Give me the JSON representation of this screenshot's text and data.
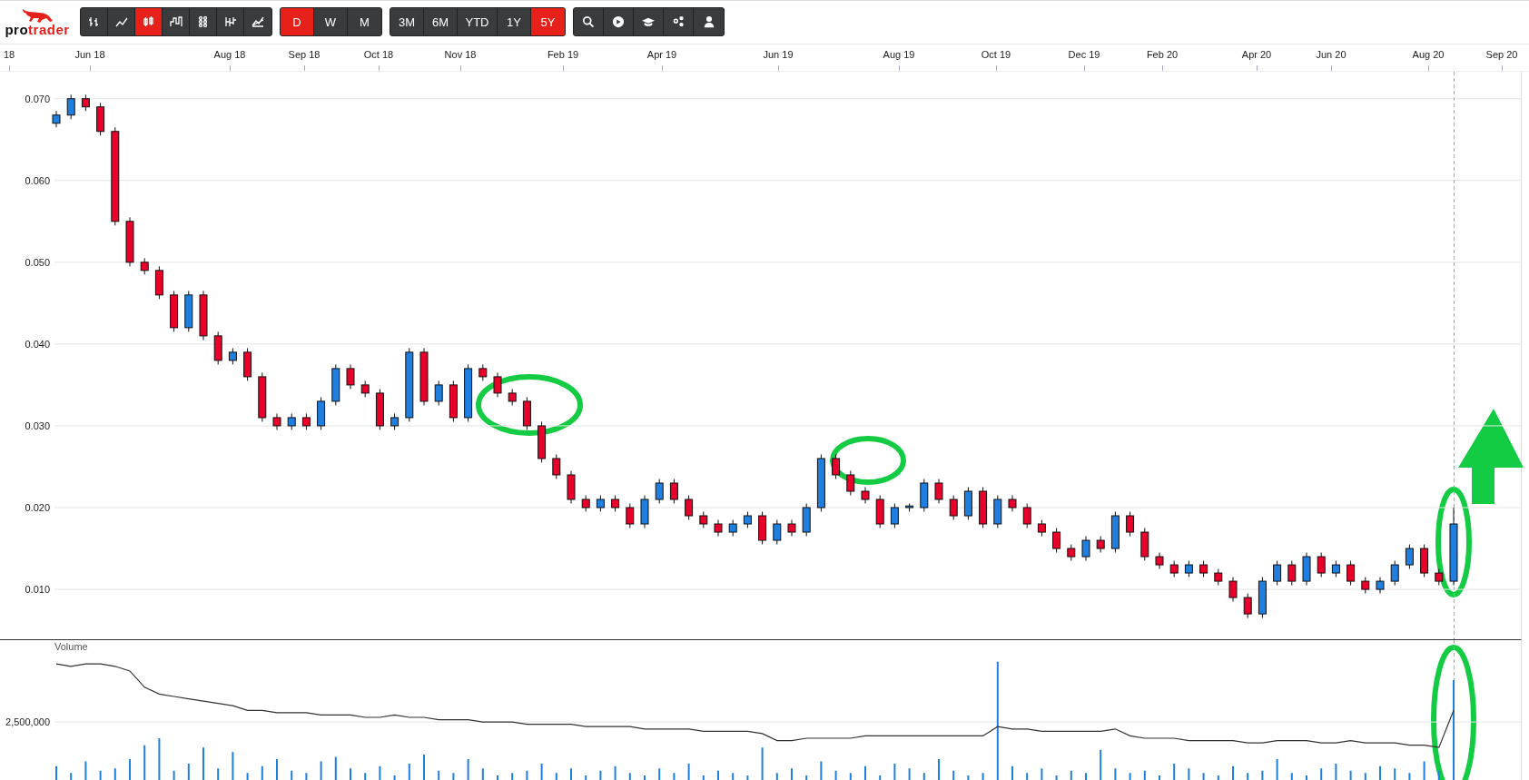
{
  "logo": {
    "prefix": "pro",
    "suffix": "trader"
  },
  "chart_types": [
    {
      "selected": false
    },
    {
      "selected": false
    },
    {
      "selected": true
    },
    {
      "selected": false
    },
    {
      "selected": false
    },
    {
      "selected": false
    },
    {
      "selected": false
    }
  ],
  "intervals": [
    {
      "label": "D",
      "selected": true
    },
    {
      "label": "W",
      "selected": false
    },
    {
      "label": "M",
      "selected": false
    }
  ],
  "ranges": [
    {
      "label": "3M",
      "selected": false
    },
    {
      "label": "6M",
      "selected": false
    },
    {
      "label": "YTD",
      "selected": false
    },
    {
      "label": "1Y",
      "selected": false
    },
    {
      "label": "5Y",
      "selected": true
    }
  ],
  "time_axis": [
    "18",
    "Jun 18",
    "Aug 18",
    "Sep 18",
    "Oct 18",
    "Nov 18",
    "Feb 19",
    "Apr 19",
    "Jun 19",
    "Aug 19",
    "Oct 19",
    "Dec 19",
    "Feb 20",
    "Apr 20",
    "Jun 20",
    "Aug 20",
    "Sep 20"
  ],
  "price_chart": {
    "chart_data": {
      "type": "candlestick",
      "grid": true,
      "ylim": [
        0.0039,
        0.0733
      ],
      "yticks": [
        {
          "value": 0.01,
          "label": "0.010"
        },
        {
          "value": 0.02,
          "label": "0.020"
        },
        {
          "value": 0.03,
          "label": "0.030"
        },
        {
          "value": 0.04,
          "label": "0.040"
        },
        {
          "value": 0.05,
          "label": "0.050"
        },
        {
          "value": 0.06,
          "label": "0.060"
        },
        {
          "value": 0.07,
          "label": "0.070"
        }
      ],
      "categories": [
        null,
        null,
        null,
        null,
        null,
        null,
        null,
        null,
        null,
        null,
        null,
        null,
        null,
        null,
        null,
        null,
        null,
        null,
        null,
        null,
        null,
        null,
        null,
        null,
        null,
        null,
        null,
        null,
        null,
        null,
        null,
        null,
        null,
        null,
        null,
        null,
        null,
        null,
        null,
        null,
        null,
        null,
        null,
        null,
        null,
        null,
        null,
        null,
        null,
        null,
        null,
        null,
        null,
        null,
        null,
        null,
        null,
        null,
        null,
        null,
        null,
        null,
        null,
        null,
        null,
        null,
        null,
        null,
        null,
        null,
        null,
        null,
        null,
        null,
        null,
        null,
        null,
        null,
        null,
        null,
        null,
        null,
        null,
        null,
        null,
        null,
        null,
        null,
        null,
        null,
        null,
        null,
        null,
        null,
        null,
        null
      ],
      "ohlc": [
        [
          0.067,
          0.0685,
          0.0665,
          0.068
        ],
        [
          0.068,
          0.0705,
          0.0675,
          0.07
        ],
        [
          0.07,
          0.0705,
          0.0685,
          0.069
        ],
        [
          0.069,
          0.0695,
          0.0655,
          0.066
        ],
        [
          0.066,
          0.0665,
          0.0545,
          0.055
        ],
        [
          0.055,
          0.0555,
          0.0495,
          0.05
        ],
        [
          0.05,
          0.0505,
          0.0485,
          0.049
        ],
        [
          0.049,
          0.0495,
          0.0455,
          0.046
        ],
        [
          0.046,
          0.0465,
          0.0415,
          0.042
        ],
        [
          0.042,
          0.0465,
          0.0415,
          0.046
        ],
        [
          0.046,
          0.0465,
          0.0405,
          0.041
        ],
        [
          0.041,
          0.0415,
          0.0375,
          0.038
        ],
        [
          0.038,
          0.0395,
          0.0375,
          0.039
        ],
        [
          0.039,
          0.0395,
          0.0355,
          0.036
        ],
        [
          0.036,
          0.0365,
          0.0305,
          0.031
        ],
        [
          0.031,
          0.0315,
          0.0295,
          0.03
        ],
        [
          0.03,
          0.0315,
          0.0295,
          0.031
        ],
        [
          0.031,
          0.0315,
          0.0295,
          0.03
        ],
        [
          0.03,
          0.0335,
          0.0295,
          0.033
        ],
        [
          0.033,
          0.0375,
          0.0325,
          0.037
        ],
        [
          0.037,
          0.0375,
          0.0345,
          0.035
        ],
        [
          0.035,
          0.0355,
          0.0335,
          0.034
        ],
        [
          0.034,
          0.0345,
          0.0295,
          0.03
        ],
        [
          0.03,
          0.0315,
          0.0295,
          0.031
        ],
        [
          0.031,
          0.0395,
          0.0305,
          0.039
        ],
        [
          0.039,
          0.0395,
          0.0325,
          0.033
        ],
        [
          0.033,
          0.0355,
          0.0325,
          0.035
        ],
        [
          0.035,
          0.0355,
          0.0305,
          0.031
        ],
        [
          0.031,
          0.0375,
          0.0305,
          0.037
        ],
        [
          0.037,
          0.0375,
          0.0355,
          0.036
        ],
        [
          0.036,
          0.0365,
          0.0335,
          0.034
        ],
        [
          0.034,
          0.0345,
          0.0325,
          0.033
        ],
        [
          0.033,
          0.0335,
          0.0295,
          0.03
        ],
        [
          0.03,
          0.0305,
          0.0255,
          0.026
        ],
        [
          0.026,
          0.0265,
          0.0235,
          0.024
        ],
        [
          0.024,
          0.0245,
          0.0205,
          0.021
        ],
        [
          0.021,
          0.0215,
          0.0195,
          0.02
        ],
        [
          0.02,
          0.0215,
          0.0195,
          0.021
        ],
        [
          0.021,
          0.0215,
          0.0195,
          0.02
        ],
        [
          0.02,
          0.0205,
          0.0175,
          0.018
        ],
        [
          0.018,
          0.0215,
          0.0175,
          0.021
        ],
        [
          0.021,
          0.0235,
          0.0205,
          0.023
        ],
        [
          0.023,
          0.0235,
          0.0205,
          0.021
        ],
        [
          0.021,
          0.0215,
          0.0185,
          0.019
        ],
        [
          0.019,
          0.0195,
          0.0175,
          0.018
        ],
        [
          0.018,
          0.0185,
          0.0165,
          0.017
        ],
        [
          0.017,
          0.0185,
          0.0165,
          0.018
        ],
        [
          0.018,
          0.0195,
          0.0175,
          0.019
        ],
        [
          0.019,
          0.0195,
          0.0155,
          0.016
        ],
        [
          0.016,
          0.0185,
          0.0155,
          0.018
        ],
        [
          0.018,
          0.0185,
          0.0165,
          0.017
        ],
        [
          0.017,
          0.0205,
          0.0165,
          0.02
        ],
        [
          0.02,
          0.0265,
          0.0195,
          0.026
        ],
        [
          0.026,
          0.0265,
          0.0235,
          0.024
        ],
        [
          0.024,
          0.0245,
          0.0215,
          0.022
        ],
        [
          0.022,
          0.0225,
          0.0205,
          0.021
        ],
        [
          0.021,
          0.0215,
          0.0175,
          0.018
        ],
        [
          0.018,
          0.0205,
          0.0175,
          0.02
        ],
        [
          0.02,
          0.0205,
          0.0195,
          0.0202
        ],
        [
          0.02,
          0.0235,
          0.0195,
          0.023
        ],
        [
          0.023,
          0.0235,
          0.0205,
          0.021
        ],
        [
          0.021,
          0.0215,
          0.0185,
          0.019
        ],
        [
          0.019,
          0.0225,
          0.0185,
          0.022
        ],
        [
          0.022,
          0.0225,
          0.0175,
          0.018
        ],
        [
          0.018,
          0.0215,
          0.0175,
          0.021
        ],
        [
          0.021,
          0.0215,
          0.0195,
          0.02
        ],
        [
          0.02,
          0.0205,
          0.0175,
          0.018
        ],
        [
          0.018,
          0.0185,
          0.0165,
          0.017
        ],
        [
          0.017,
          0.0175,
          0.0145,
          0.015
        ],
        [
          0.015,
          0.0155,
          0.0135,
          0.014
        ],
        [
          0.014,
          0.0165,
          0.0135,
          0.016
        ],
        [
          0.016,
          0.0165,
          0.0145,
          0.015
        ],
        [
          0.015,
          0.0195,
          0.0145,
          0.019
        ],
        [
          0.019,
          0.0195,
          0.0165,
          0.017
        ],
        [
          0.017,
          0.0175,
          0.0135,
          0.014
        ],
        [
          0.014,
          0.0145,
          0.0125,
          0.013
        ],
        [
          0.013,
          0.0135,
          0.0115,
          0.012
        ],
        [
          0.012,
          0.0135,
          0.0115,
          0.013
        ],
        [
          0.013,
          0.0135,
          0.0115,
          0.012
        ],
        [
          0.012,
          0.0125,
          0.0105,
          0.011
        ],
        [
          0.011,
          0.0115,
          0.0085,
          0.009
        ],
        [
          0.009,
          0.0095,
          0.0065,
          0.007
        ],
        [
          0.007,
          0.0115,
          0.0065,
          0.011
        ],
        [
          0.011,
          0.0135,
          0.0105,
          0.013
        ],
        [
          0.013,
          0.0135,
          0.0105,
          0.011
        ],
        [
          0.011,
          0.0145,
          0.0105,
          0.014
        ],
        [
          0.014,
          0.0145,
          0.0115,
          0.012
        ],
        [
          0.012,
          0.0135,
          0.0115,
          0.013
        ],
        [
          0.013,
          0.0135,
          0.0105,
          0.011
        ],
        [
          0.011,
          0.0115,
          0.0095,
          0.01
        ],
        [
          0.01,
          0.0115,
          0.0095,
          0.011
        ],
        [
          0.011,
          0.0135,
          0.0105,
          0.013
        ],
        [
          0.013,
          0.0155,
          0.0125,
          0.015
        ],
        [
          0.015,
          0.0155,
          0.0115,
          0.012
        ],
        [
          0.012,
          0.0125,
          0.0105,
          0.011
        ],
        [
          0.011,
          0.02,
          0.0105,
          0.018
        ]
      ]
    }
  },
  "volume_chart": {
    "title": "Volume",
    "scale_label": "2,500,000"
  }
}
